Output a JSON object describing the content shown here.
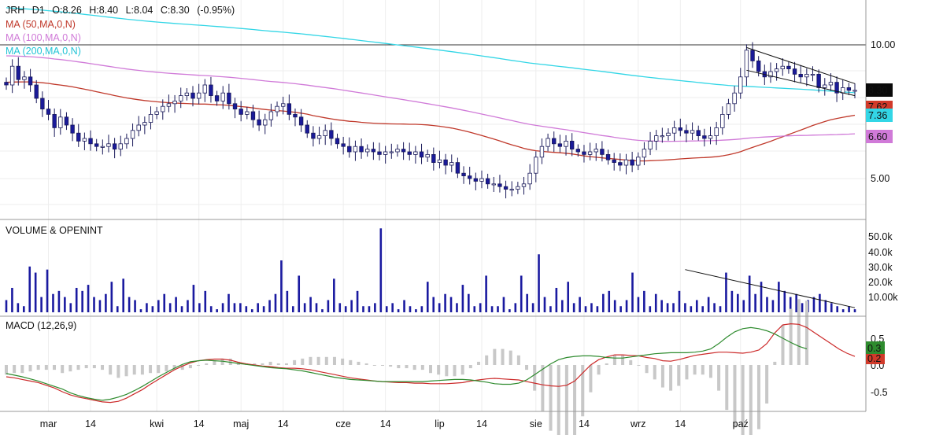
{
  "chart_data": [
    {
      "type": "candlestick",
      "panel": "price",
      "header": {
        "symbol": "JRH",
        "interval": "D1",
        "open": "O:8.26",
        "high": "H:8.40",
        "low": "L:8.04",
        "close": "C:8.30",
        "change": "(-0.95%)"
      },
      "indicators": [
        {
          "name": "MA (50,MA,0,N)",
          "color": "#c0392b"
        },
        {
          "name": "MA (100,MA,0,N)",
          "color": "#d07ad8"
        },
        {
          "name": "MA (200,MA,0,N)",
          "color": "#33d6e6"
        }
      ],
      "y_ticks": [
        "10.00",
        "5.00"
      ],
      "last_values": {
        "close": "8.30",
        "ma50": "7.62",
        "ma200": "7.36",
        "ma100": "6.60"
      },
      "reference_line": 10.0,
      "closes": [
        8.5,
        9.2,
        8.7,
        8.8,
        8.5,
        8.0,
        7.6,
        7.4,
        6.9,
        7.3,
        7.0,
        6.7,
        6.4,
        6.5,
        6.3,
        6.2,
        6.2,
        6.3,
        6.1,
        6.3,
        6.5,
        6.8,
        7.0,
        7.1,
        7.4,
        7.5,
        7.7,
        7.8,
        7.9,
        8.1,
        8.2,
        8.0,
        8.2,
        8.5,
        8.1,
        7.9,
        8.2,
        7.8,
        7.6,
        7.4,
        7.5,
        7.2,
        7.0,
        7.2,
        7.5,
        7.7,
        7.8,
        7.4,
        7.3,
        7.0,
        6.7,
        6.5,
        6.6,
        6.8,
        6.5,
        6.3,
        6.2,
        6.0,
        6.2,
        6.0,
        6.1,
        6.0,
        5.9,
        6.0,
        6.0,
        6.1,
        6.0,
        5.9,
        6.0,
        5.8,
        5.9,
        5.6,
        5.7,
        5.5,
        5.6,
        5.2,
        5.1,
        5.0,
        4.9,
        5.0,
        4.8,
        4.8,
        4.7,
        4.6,
        4.6,
        4.7,
        4.8,
        5.2,
        5.8,
        6.2,
        6.5,
        6.3,
        6.2,
        6.4,
        6.1,
        6.0,
        5.9,
        6.0,
        6.1,
        5.9,
        5.7,
        5.6,
        5.5,
        5.7,
        5.5,
        5.8,
        6.1,
        6.4,
        6.6,
        6.6,
        6.7,
        6.9,
        6.8,
        6.7,
        6.8,
        6.6,
        6.5,
        6.6,
        6.9,
        7.4,
        7.8,
        8.2,
        8.8,
        9.8,
        9.4,
        9.0,
        8.8,
        9.0,
        9.1,
        9.2,
        9.1,
        8.9,
        8.8,
        8.9,
        8.9,
        8.4,
        8.5,
        8.6,
        8.2,
        8.4,
        8.3,
        8.3
      ],
      "x_ticks": [
        {
          "label": "mar",
          "i": 7
        },
        {
          "label": "14",
          "i": 14
        },
        {
          "label": "kwi",
          "i": 25
        },
        {
          "label": "14",
          "i": 32
        },
        {
          "label": "maj",
          "i": 39
        },
        {
          "label": "14",
          "i": 46
        },
        {
          "label": "cze",
          "i": 56
        },
        {
          "label": "14",
          "i": 63
        },
        {
          "label": "lip",
          "i": 72
        },
        {
          "label": "14",
          "i": 79
        },
        {
          "label": "sie",
          "i": 88
        },
        {
          "label": "14",
          "i": 96
        },
        {
          "label": "wrz",
          "i": 105
        },
        {
          "label": "14",
          "i": 112
        },
        {
          "label": "paź",
          "i": 122
        }
      ]
    },
    {
      "type": "bar",
      "panel": "volume",
      "title": "VOLUME & OPENINT",
      "y_ticks": [
        "50.0k",
        "40.0k",
        "30.0k",
        "20.0k",
        "10.00k"
      ],
      "values": [
        8,
        16,
        6,
        4,
        30,
        26,
        10,
        28,
        12,
        14,
        10,
        6,
        16,
        14,
        18,
        10,
        8,
        12,
        20,
        4,
        22,
        10,
        8,
        2,
        6,
        4,
        8,
        12,
        6,
        10,
        4,
        8,
        18,
        6,
        14,
        4,
        2,
        6,
        12,
        6,
        6,
        4,
        2,
        6,
        4,
        8,
        12,
        34,
        14,
        4,
        24,
        6,
        10,
        6,
        2,
        8,
        22,
        6,
        4,
        8,
        14,
        4,
        4,
        6,
        55,
        4,
        6,
        2,
        8,
        4,
        2,
        4,
        20,
        10,
        6,
        12,
        10,
        6,
        18,
        12,
        4,
        6,
        24,
        4,
        4,
        10,
        2,
        6,
        24,
        12,
        6,
        38,
        10,
        4,
        16,
        8,
        20,
        6,
        10,
        4,
        6,
        4,
        12,
        14,
        8,
        4,
        8,
        26,
        10,
        14,
        4,
        12,
        8,
        6,
        6,
        14,
        6,
        4,
        8,
        4,
        10,
        6,
        4,
        26,
        14,
        12,
        8,
        24,
        12,
        20,
        10,
        8,
        20,
        14,
        10,
        12,
        6,
        8,
        10,
        12,
        8,
        6,
        4,
        2,
        4,
        2
      ],
      "trendline": true
    },
    {
      "type": "line",
      "panel": "macd",
      "title": "MACD (12,26,9)",
      "y_ticks": [
        "0.5",
        "0.0",
        "-0.5"
      ],
      "last_values": {
        "signal": "0.3",
        "macd": "0.2"
      },
      "series": [
        {
          "name": "MACD",
          "color": "#cc2a2a",
          "values": [
            -0.22,
            -0.24,
            -0.27,
            -0.3,
            -0.33,
            -0.38,
            -0.43,
            -0.5,
            -0.56,
            -0.6,
            -0.63,
            -0.66,
            -0.69,
            -0.7,
            -0.68,
            -0.62,
            -0.54,
            -0.46,
            -0.36,
            -0.27,
            -0.18,
            -0.09,
            -0.02,
            0.04,
            0.08,
            0.1,
            0.11,
            0.11,
            0.09,
            0.05,
            0.02,
            0.0,
            -0.02,
            -0.03,
            -0.05,
            -0.06,
            -0.06,
            -0.07,
            -0.09,
            -0.12,
            -0.15,
            -0.18,
            -0.21,
            -0.24,
            -0.26,
            -0.28,
            -0.3,
            -0.31,
            -0.32,
            -0.33,
            -0.33,
            -0.34,
            -0.34,
            -0.35,
            -0.35,
            -0.35,
            -0.34,
            -0.33,
            -0.3,
            -0.28,
            -0.26,
            -0.25,
            -0.26,
            -0.27,
            -0.28,
            -0.31,
            -0.34,
            -0.37,
            -0.39,
            -0.4,
            -0.38,
            -0.3,
            -0.15,
            0.0,
            0.1,
            0.15,
            0.19,
            0.19,
            0.18,
            0.17,
            0.14,
            0.12,
            0.08,
            0.07,
            0.1,
            0.14,
            0.18,
            0.2,
            0.22,
            0.24,
            0.24,
            0.23,
            0.22,
            0.24,
            0.28,
            0.4,
            0.6,
            0.75,
            0.77,
            0.76,
            0.7,
            0.6,
            0.5,
            0.4,
            0.3,
            0.22,
            0.16
          ]
        },
        {
          "name": "Signal",
          "color": "#2e8b2e",
          "values": [
            -0.16,
            -0.19,
            -0.22,
            -0.26,
            -0.3,
            -0.35,
            -0.4,
            -0.45,
            -0.52,
            -0.57,
            -0.61,
            -0.64,
            -0.66,
            -0.64,
            -0.6,
            -0.55,
            -0.48,
            -0.4,
            -0.31,
            -0.22,
            -0.14,
            -0.06,
            0.01,
            0.06,
            0.08,
            0.09,
            0.08,
            0.07,
            0.05,
            0.03,
            0.01,
            -0.01,
            -0.03,
            -0.05,
            -0.06,
            -0.07,
            -0.09,
            -0.11,
            -0.14,
            -0.17,
            -0.2,
            -0.23,
            -0.25,
            -0.27,
            -0.28,
            -0.29,
            -0.3,
            -0.31,
            -0.31,
            -0.31,
            -0.31,
            -0.31,
            -0.31,
            -0.3,
            -0.29,
            -0.28,
            -0.27,
            -0.27,
            -0.28,
            -0.3,
            -0.32,
            -0.35,
            -0.36,
            -0.36,
            -0.34,
            -0.28,
            -0.18,
            -0.08,
            0.02,
            0.1,
            0.14,
            0.16,
            0.17,
            0.17,
            0.16,
            0.14,
            0.13,
            0.13,
            0.15,
            0.17,
            0.19,
            0.21,
            0.22,
            0.23,
            0.23,
            0.23,
            0.24,
            0.26,
            0.3,
            0.4,
            0.52,
            0.62,
            0.68,
            0.7,
            0.68,
            0.64,
            0.58,
            0.5,
            0.42,
            0.35,
            0.3
          ]
        }
      ]
    }
  ]
}
